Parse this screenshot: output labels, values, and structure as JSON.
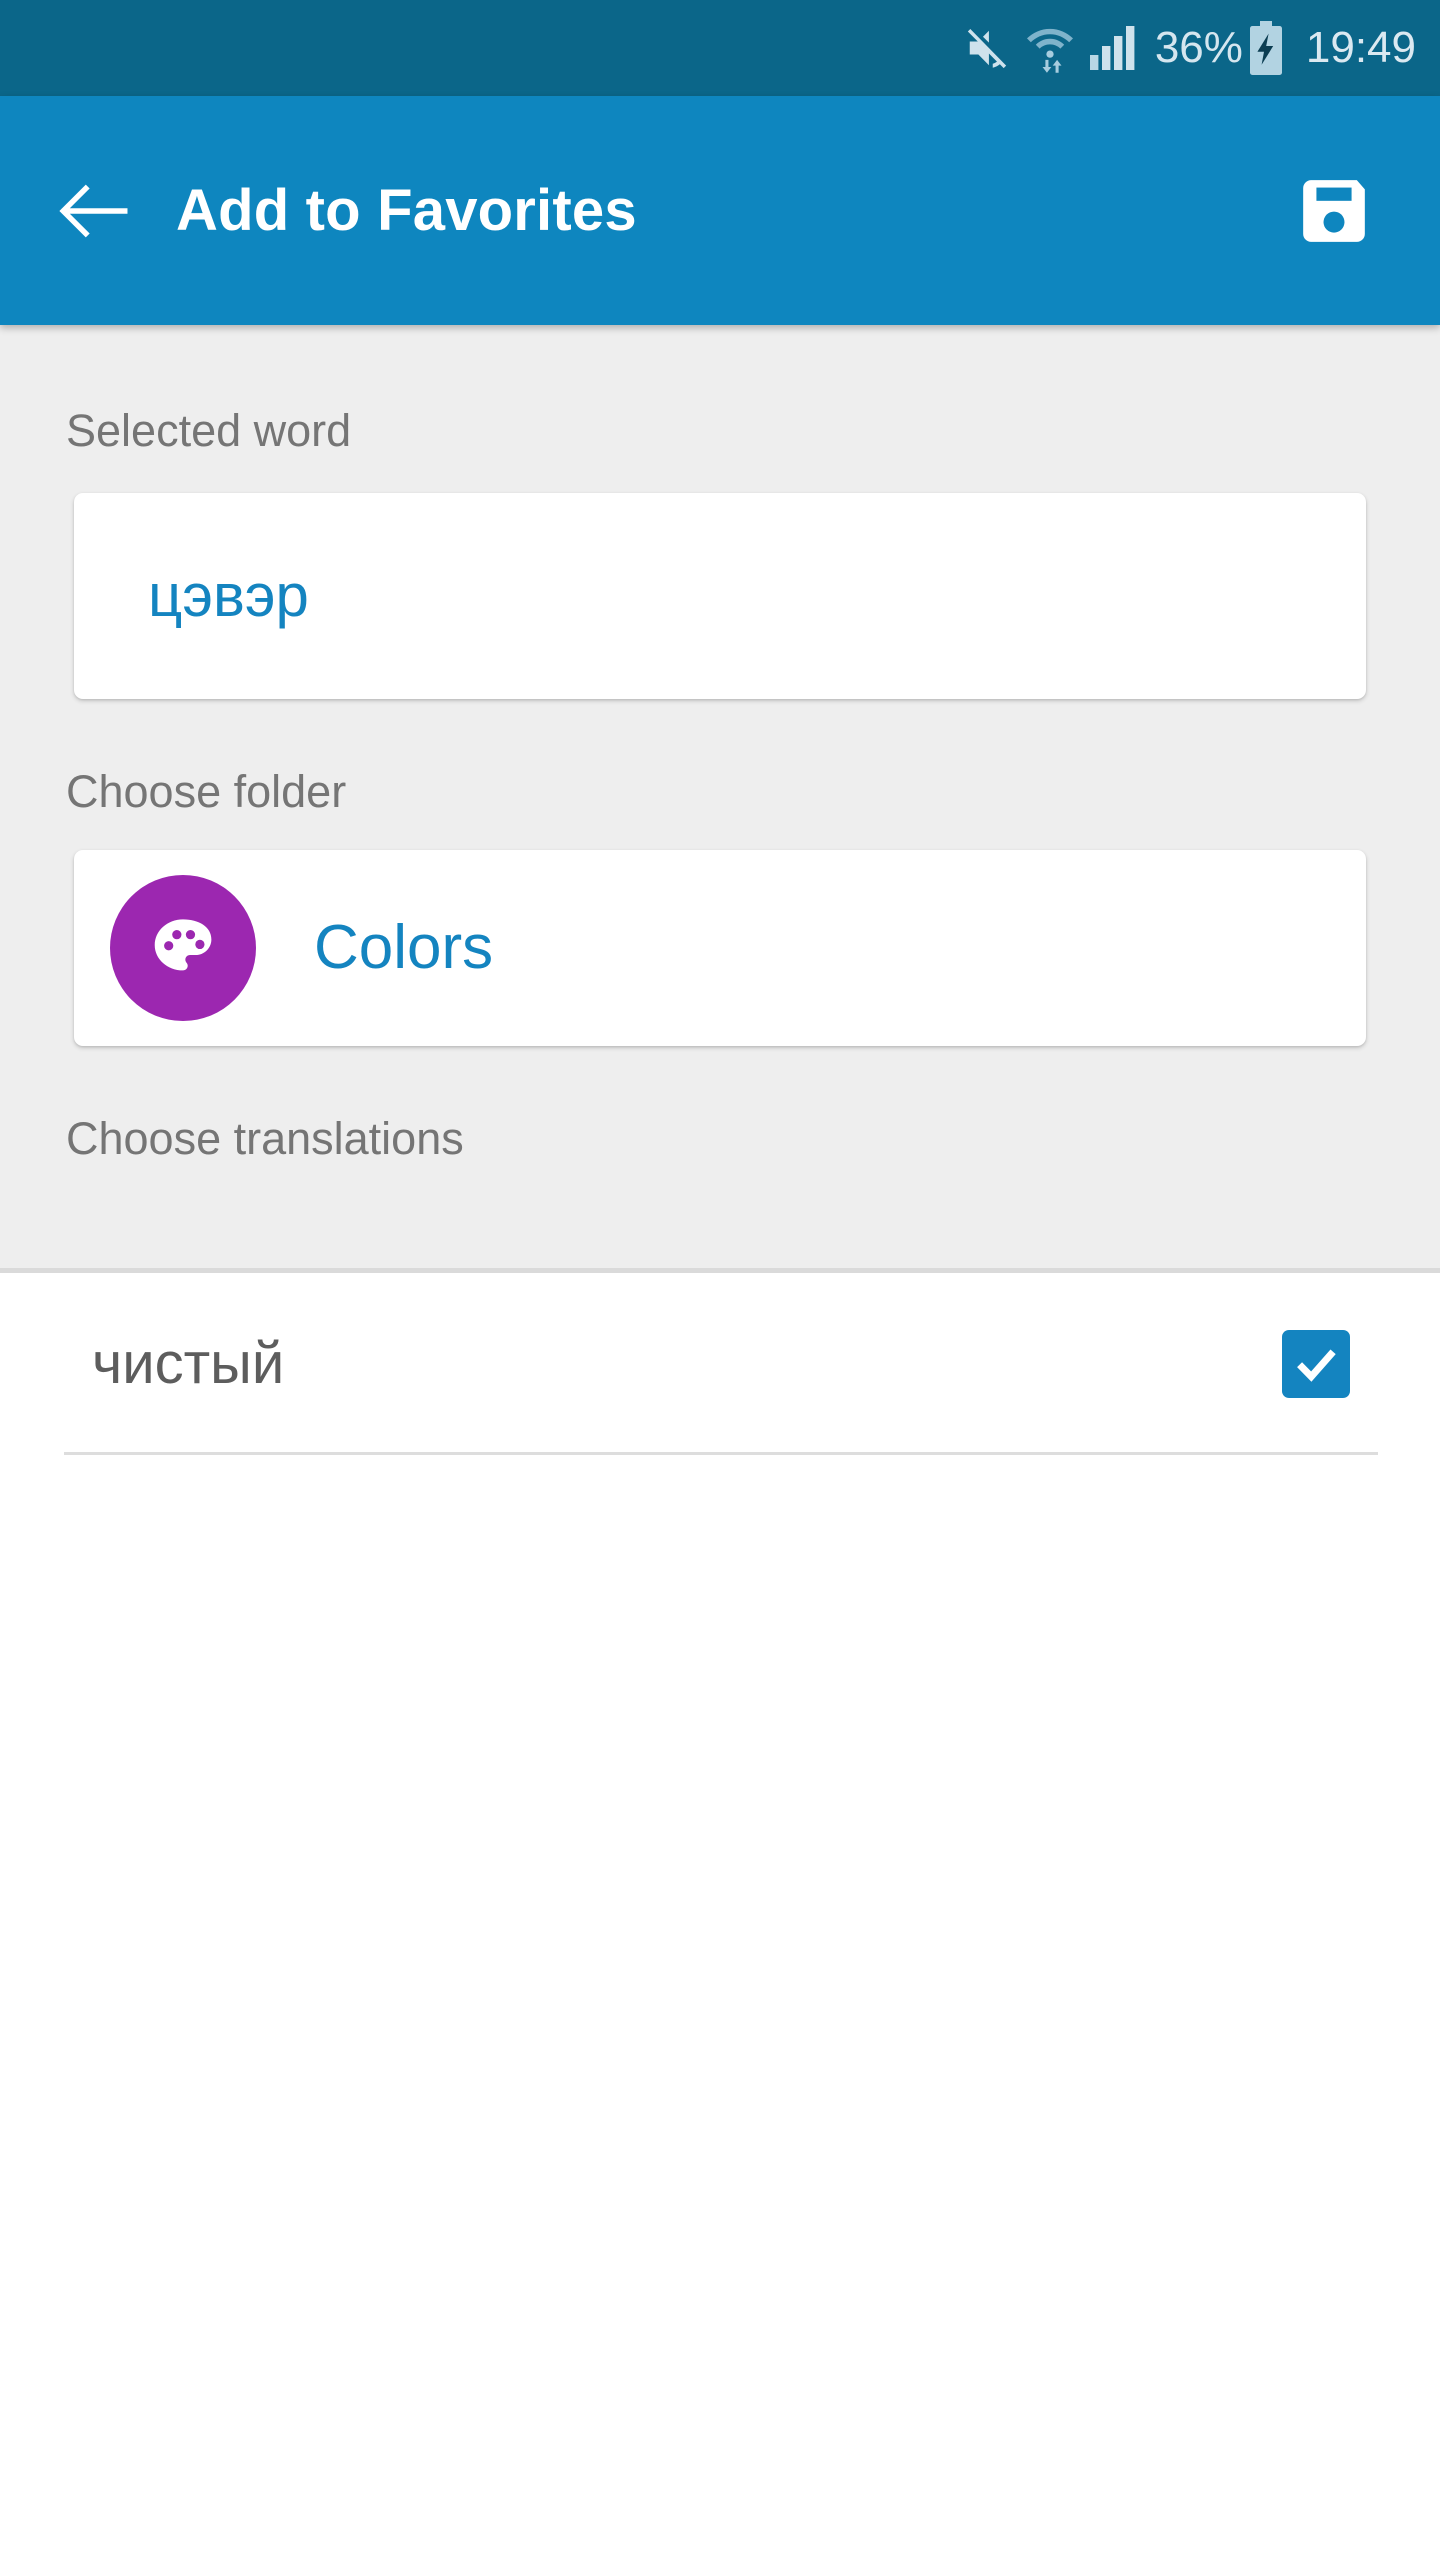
{
  "status_bar": {
    "background": "#0b6689",
    "icons": [
      {
        "name": "mute-icon",
        "label": "mute"
      },
      {
        "name": "wifi-icon",
        "label": "wifi"
      },
      {
        "name": "signal-icon",
        "label": "signal"
      }
    ],
    "battery_percent": "36%",
    "battery_state": "charging",
    "time": "19:49"
  },
  "app_bar": {
    "background": "#0e86bf",
    "title": "Add to Favorites",
    "back_icon": "arrow-left-icon",
    "save_icon": "save-floppy-icon"
  },
  "content": {
    "background": "#eeeeee",
    "accent": "#1484c0",
    "selected_word": {
      "label": "Selected word",
      "value": "цэвэр"
    },
    "choose_folder": {
      "label": "Choose folder",
      "folder_name": "Colors",
      "folder_icon": "palette-icon",
      "folder_icon_color": "#9c27b0"
    },
    "choose_translations": {
      "label": "Choose translations",
      "items": [
        {
          "text": "чистый",
          "checked": true
        }
      ]
    }
  }
}
